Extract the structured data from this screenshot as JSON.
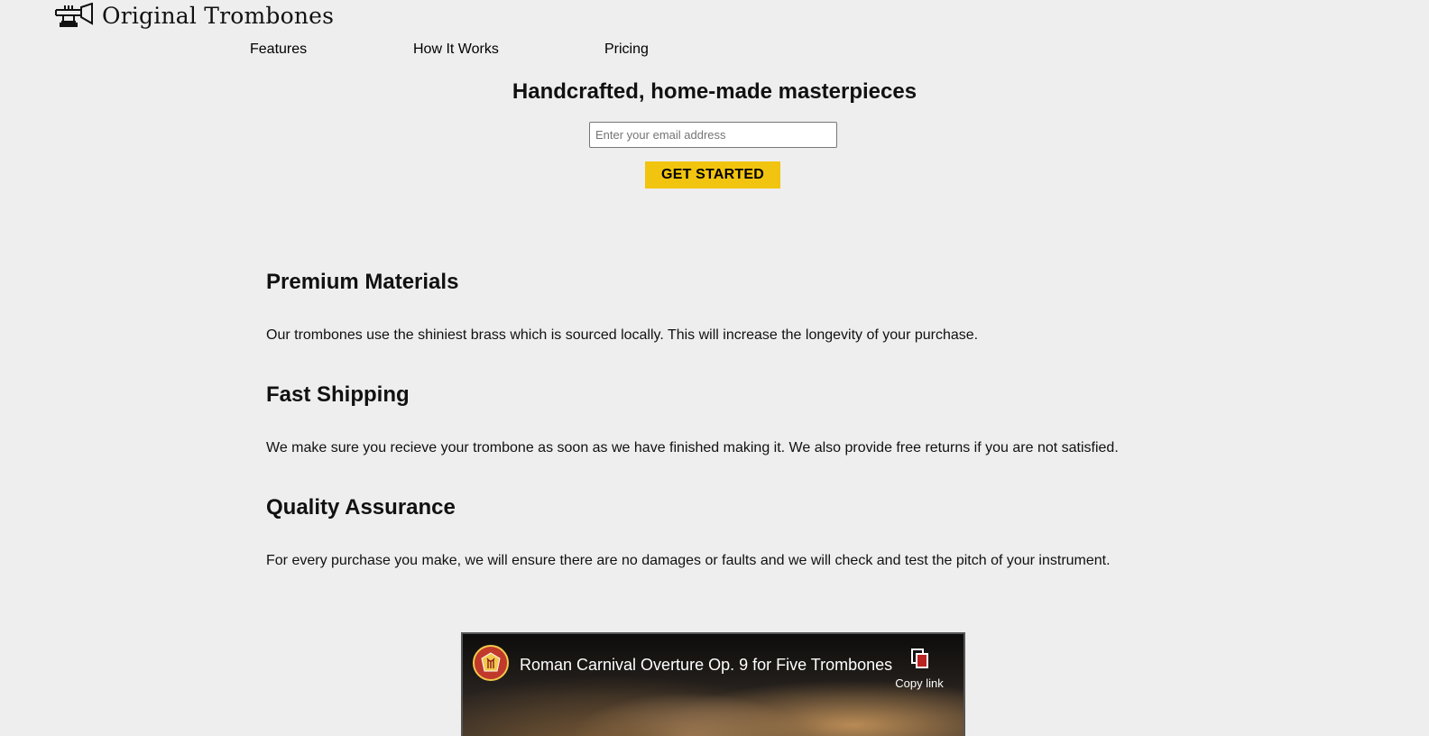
{
  "header": {
    "brand": "Original Trombones",
    "logo_icon": "trombone-icon"
  },
  "nav": {
    "items": [
      {
        "label": "Features"
      },
      {
        "label": "How It Works"
      },
      {
        "label": "Pricing"
      }
    ]
  },
  "hero": {
    "title": "Handcrafted, home-made masterpieces",
    "email_placeholder": "Enter your email address",
    "email_value": "",
    "cta_label": "GET STARTED"
  },
  "features": [
    {
      "title": "Premium Materials",
      "description": "Our trombones use the shiniest brass which is sourced locally. This will increase the longevity of your purchase."
    },
    {
      "title": "Fast Shipping",
      "description": "We make sure you recieve your trombone as soon as we have finished making it. We also provide free returns if you are not satisfied."
    },
    {
      "title": "Quality Assurance",
      "description": "For every purchase you make, we will ensure there are no damages or faults and we will check and test the pitch of your instrument."
    }
  ],
  "video": {
    "title": "Roman Carnival Overture Op. 9 for Five Trombones",
    "copy_link_label": "Copy link",
    "channel_icon": "channel-avatar-icon",
    "copy_icon": "copy-icon"
  },
  "colors": {
    "background": "#eeeeee",
    "cta": "#f1c40f"
  }
}
